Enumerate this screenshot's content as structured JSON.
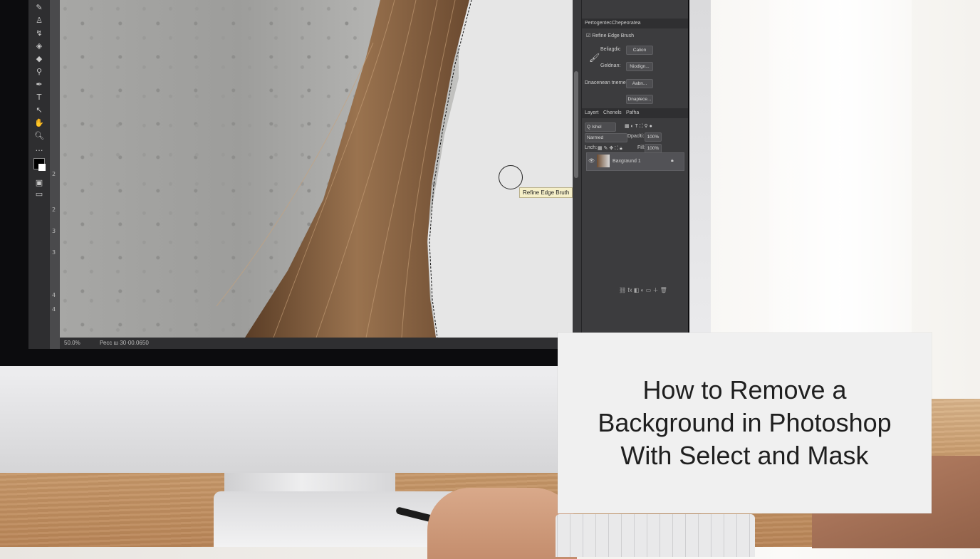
{
  "tooltip": {
    "text": "Refine Edge Bruth"
  },
  "status_bar": {
    "zoom": "50.0%",
    "doc_info": "Ресс ш 30·00.0650"
  },
  "title_card": {
    "line1": "How to Remove a",
    "line2": "Background in Photoshop",
    "line3": "With Select and Mask"
  },
  "properties_panel": {
    "tabs": [
      "Pertogentec",
      "Chepeoratea"
    ],
    "checkbox_label": "Refine Edge Brush",
    "rows": [
      {
        "label": "Beliagdic",
        "button": "Calion"
      },
      {
        "label": "Geldnan:",
        "button": "Niodign..."
      },
      {
        "label": "Dnacenean tnernec",
        "button": "Aabn..."
      },
      {
        "label": "",
        "button": "Dnaplece..."
      }
    ]
  },
  "layers_panel": {
    "tabs": [
      "Layert",
      "Chenels",
      "Pafha"
    ],
    "filter": "Q Ishel",
    "blend_mode": "Narmed",
    "opacity_label": "Dpaclti:",
    "opacity_value": "100%",
    "lock_label": "Lnch:",
    "fill_label": "Fill:",
    "fill_value": "100%",
    "layer_name": "Baxgraund 1"
  },
  "ruler_numbers": [
    "2",
    "2",
    "3",
    "3",
    "4",
    "4"
  ],
  "colors": {
    "ps_toolbar": "#2e2e30",
    "ps_panel": "#3c3c3e",
    "tooltip_bg": "#f5efc8",
    "title_text": "#1f1f1f",
    "hair": "#8a6442"
  }
}
